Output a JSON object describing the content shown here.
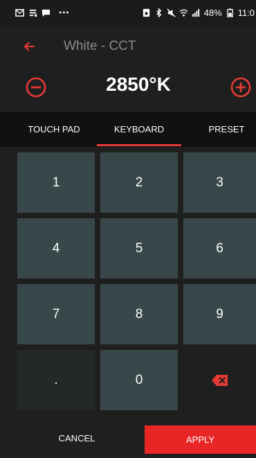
{
  "status_bar": {
    "battery_text": "48%",
    "time_text": "11:0"
  },
  "app_bar": {
    "title": "White - CCT",
    "back_icon": "back-arrow-icon"
  },
  "value": {
    "display": "2850°K"
  },
  "tabs": [
    {
      "label": "TOUCH PAD"
    },
    {
      "label": "KEYBOARD",
      "active": true
    },
    {
      "label": "PRESET"
    }
  ],
  "keypad": {
    "k1": "1",
    "k2": "2",
    "k3": "3",
    "k4": "4",
    "k5": "5",
    "k6": "6",
    "k7": "7",
    "k8": "8",
    "k9": "9",
    "kdot": ".",
    "k0": "0",
    "backspace_icon": "backspace-icon"
  },
  "buttons": {
    "cancel": "CANCEL",
    "apply": "APPLY"
  },
  "colors": {
    "accent": "#e53935",
    "key_bg": "#384749",
    "background": "#1f1f1f"
  }
}
